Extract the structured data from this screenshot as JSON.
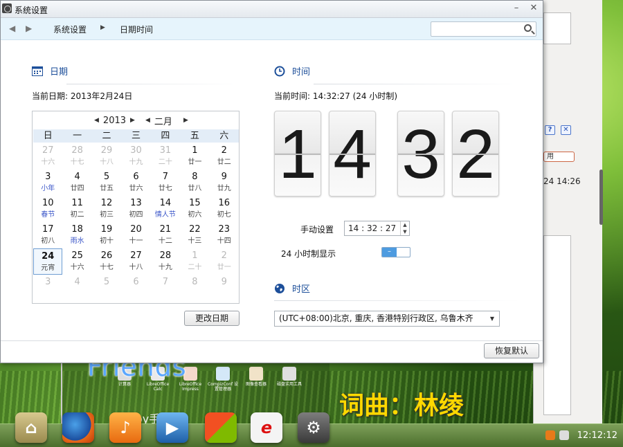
{
  "window": {
    "title": "系统设置"
  },
  "nav": {
    "crumbs": [
      "系统设置",
      "日期时间"
    ],
    "search_placeholder": ""
  },
  "date": {
    "heading": "日期",
    "current_label": "当前日期:",
    "current_value": "2013年2月24日",
    "year": "2013",
    "month": "二月",
    "weekdays": [
      "日",
      "一",
      "二",
      "三",
      "四",
      "五",
      "六"
    ],
    "days": [
      {
        "d": "27",
        "l": "十六",
        "other": true
      },
      {
        "d": "28",
        "l": "十七",
        "other": true
      },
      {
        "d": "29",
        "l": "十八",
        "other": true
      },
      {
        "d": "30",
        "l": "十九",
        "other": true
      },
      {
        "d": "31",
        "l": "二十",
        "other": true
      },
      {
        "d": "1",
        "l": "廿一"
      },
      {
        "d": "2",
        "l": "廿二"
      },
      {
        "d": "3",
        "l": "小年",
        "fest": true
      },
      {
        "d": "4",
        "l": "廿四"
      },
      {
        "d": "5",
        "l": "廿五"
      },
      {
        "d": "6",
        "l": "廿六"
      },
      {
        "d": "7",
        "l": "廿七"
      },
      {
        "d": "8",
        "l": "廿八"
      },
      {
        "d": "9",
        "l": "廿九"
      },
      {
        "d": "10",
        "l": "春节",
        "fest": true
      },
      {
        "d": "11",
        "l": "初二"
      },
      {
        "d": "12",
        "l": "初三"
      },
      {
        "d": "13",
        "l": "初四"
      },
      {
        "d": "14",
        "l": "情人节",
        "fest": true
      },
      {
        "d": "15",
        "l": "初六"
      },
      {
        "d": "16",
        "l": "初七"
      },
      {
        "d": "17",
        "l": "初八"
      },
      {
        "d": "18",
        "l": "雨水",
        "fest": true
      },
      {
        "d": "19",
        "l": "初十"
      },
      {
        "d": "20",
        "l": "十一"
      },
      {
        "d": "21",
        "l": "十二"
      },
      {
        "d": "22",
        "l": "十三"
      },
      {
        "d": "23",
        "l": "十四"
      },
      {
        "d": "24",
        "l": "元宵",
        "today": true
      },
      {
        "d": "25",
        "l": "十六"
      },
      {
        "d": "26",
        "l": "十七"
      },
      {
        "d": "27",
        "l": "十八"
      },
      {
        "d": "28",
        "l": "十九"
      },
      {
        "d": "1",
        "l": "二十",
        "other": true
      },
      {
        "d": "2",
        "l": "廿一",
        "other": true
      },
      {
        "d": "3",
        "l": "",
        "other": true
      },
      {
        "d": "4",
        "l": "",
        "other": true
      },
      {
        "d": "5",
        "l": "",
        "other": true
      },
      {
        "d": "6",
        "l": "",
        "other": true
      },
      {
        "d": "7",
        "l": "",
        "other": true
      },
      {
        "d": "8",
        "l": "",
        "other": true
      },
      {
        "d": "9",
        "l": "",
        "other": true
      }
    ],
    "change_button": "更改日期"
  },
  "time": {
    "heading": "时间",
    "current_label": "当前时间:",
    "current_value": "14:32:27 (24 小时制)",
    "digits": [
      "1",
      "4",
      "3",
      "2"
    ],
    "manual_label": "手动设置",
    "manual_value": "14 : 32 : 27",
    "format_label": "24 小时制显示",
    "format_24h": true
  },
  "timezone": {
    "heading": "时区",
    "value": "(UTC+08:00)北京, 重庆, 香港特别行政区, 乌鲁木齐"
  },
  "footer": {
    "restore_button": "恢复默认"
  },
  "background_app": {
    "apply_label": "用",
    "time_text": "24 14:26",
    "help_label": "?",
    "close_label": "✕"
  },
  "desktop": {
    "icons": [
      "计算器",
      "LibreOffice Calc",
      "LibreOffice Impress",
      "CompizConf 设置管理器",
      "图像查看器",
      "磁盘实用工具"
    ]
  },
  "lyrics": {
    "line1": "Friends",
    "line2": "词曲：林绫",
    "line3": "oy手 要得"
  },
  "taskbar": {
    "clock": "12:12:12"
  },
  "colors": {
    "accent": "#1d4f9a",
    "navbar": "#e6f4fc",
    "toggle_on": "#4d9be0",
    "festival": "#3a55c8"
  }
}
